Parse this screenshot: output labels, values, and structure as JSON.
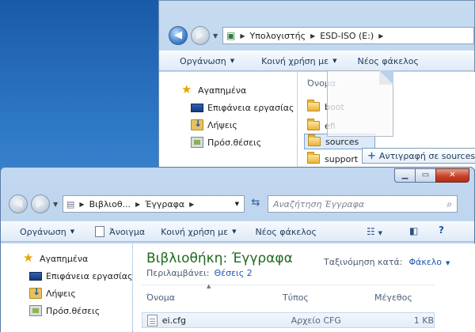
{
  "back_window": {
    "breadcrumb": [
      "Υπολογιστής",
      "ESD-ISO (E:)"
    ],
    "toolbar": {
      "organize": "Οργάνωση",
      "share": "Κοινή χρήση με",
      "new_folder": "Νέος φάκελος"
    },
    "nav": [
      "Αγαπημένα",
      "Επιφάνεια εργασίας",
      "Λήψεις",
      "Πρόσ.θέσεις"
    ],
    "column_name": "Όνομα",
    "files": [
      "boot",
      "efi",
      "sources",
      "support"
    ],
    "copy_tooltip": "Αντιγραφή σε sources"
  },
  "front_window": {
    "breadcrumb": [
      "Βιβλιοθ...",
      "Έγγραφα"
    ],
    "search_placeholder": "Αναζήτηση Έγγραφα",
    "toolbar": {
      "organize": "Οργάνωση",
      "open": "Άνοιγμα",
      "share": "Κοινή χρήση με",
      "new_folder": "Νέος φάκελος"
    },
    "nav": [
      "Αγαπημένα",
      "Επιφάνεια εργασίας",
      "Λήψεις",
      "Πρόσ.θέσεις"
    ],
    "library_title": "Βιβλιοθήκη: Έγγραφα",
    "includes_label": "Περιλαμβάνει:",
    "includes_link": "Θέσεις 2",
    "arrange_label": "Ταξινόμηση κατά:",
    "arrange_value": "Φάκελο",
    "columns": [
      "Όνομα",
      "Τύπος",
      "Μέγεθος"
    ],
    "files": [
      {
        "name": "ei.cfg",
        "type": "Αρχείο CFG",
        "size": "1 KB"
      }
    ]
  }
}
